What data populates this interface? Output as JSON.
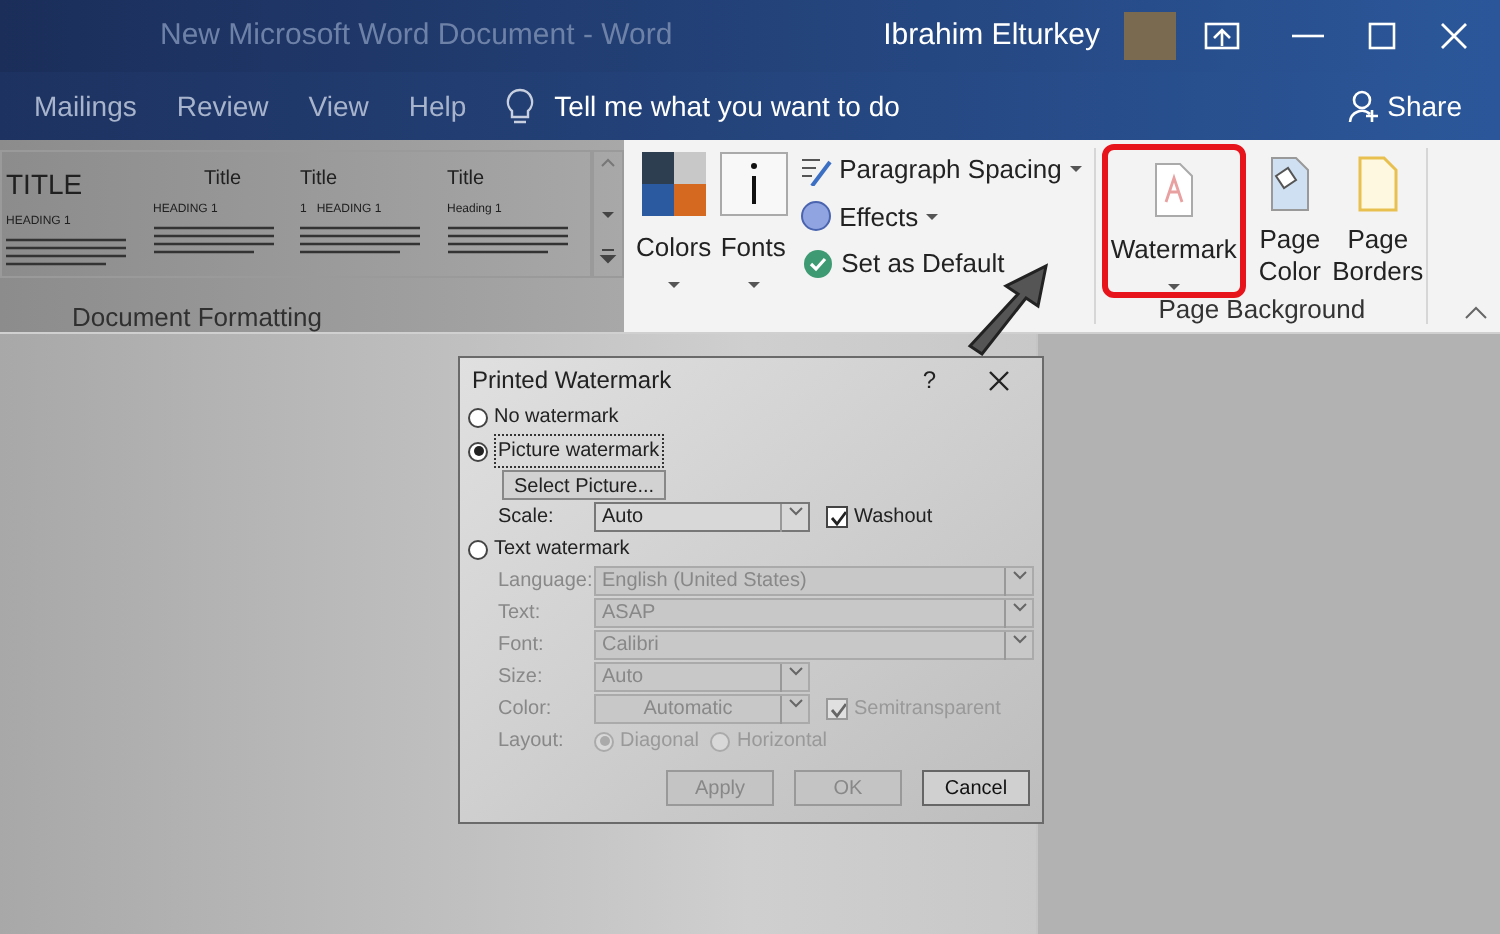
{
  "window": {
    "title": "New Microsoft Word Document  -  Word",
    "user": "Ibrahim Elturkey"
  },
  "tabs": [
    "Mailings",
    "Review",
    "View",
    "Help"
  ],
  "tell_me": "Tell me what you want to do",
  "share": "Share",
  "ribbon": {
    "styles": [
      {
        "title": "TITLE",
        "heading": "HEADING 1"
      },
      {
        "title": "Title",
        "heading": "HEADING 1"
      },
      {
        "title": "Title",
        "heading": "1   HEADING 1"
      },
      {
        "title": "Title",
        "heading": "Heading 1"
      }
    ],
    "document_formatting": "Document Formatting",
    "colors": "Colors",
    "fonts": "Fonts",
    "paragraph_spacing": "Paragraph Spacing",
    "effects": "Effects",
    "set_as_default": "Set as Default",
    "watermark": {
      "label": "Watermark",
      "highlighted": true
    },
    "page_color": "Page Color",
    "page_borders": "Page Borders",
    "page_background": "Page Background"
  },
  "dialog": {
    "title": "Printed Watermark",
    "help": "?",
    "options": [
      {
        "label": "No watermark",
        "selected": false
      },
      {
        "label": "Picture watermark",
        "selected": true
      },
      {
        "label": "Text watermark",
        "selected": false
      }
    ],
    "select_picture": "Select Picture...",
    "scale": {
      "label": "Scale:",
      "value": "Auto"
    },
    "washout": {
      "label": "Washout",
      "checked": true
    },
    "text_fields": [
      {
        "label": "Language:",
        "value": "English (United States)",
        "wide": true
      },
      {
        "label": "Text:",
        "value": "ASAP",
        "wide": true
      },
      {
        "label": "Font:",
        "value": "Calibri",
        "wide": true
      },
      {
        "label": "Size:",
        "value": "Auto",
        "wide": false
      },
      {
        "label": "Color:",
        "value": "Automatic",
        "wide": false
      }
    ],
    "semitransparent": {
      "label": "Semitransparent",
      "checked": true
    },
    "layout": {
      "label": "Layout:",
      "options": [
        {
          "label": "Diagonal",
          "selected": true
        },
        {
          "label": "Horizontal",
          "selected": false
        }
      ]
    },
    "buttons": [
      {
        "label": "Apply",
        "disabled": true
      },
      {
        "label": "OK",
        "disabled": true
      },
      {
        "label": "Cancel",
        "disabled": false
      }
    ]
  }
}
